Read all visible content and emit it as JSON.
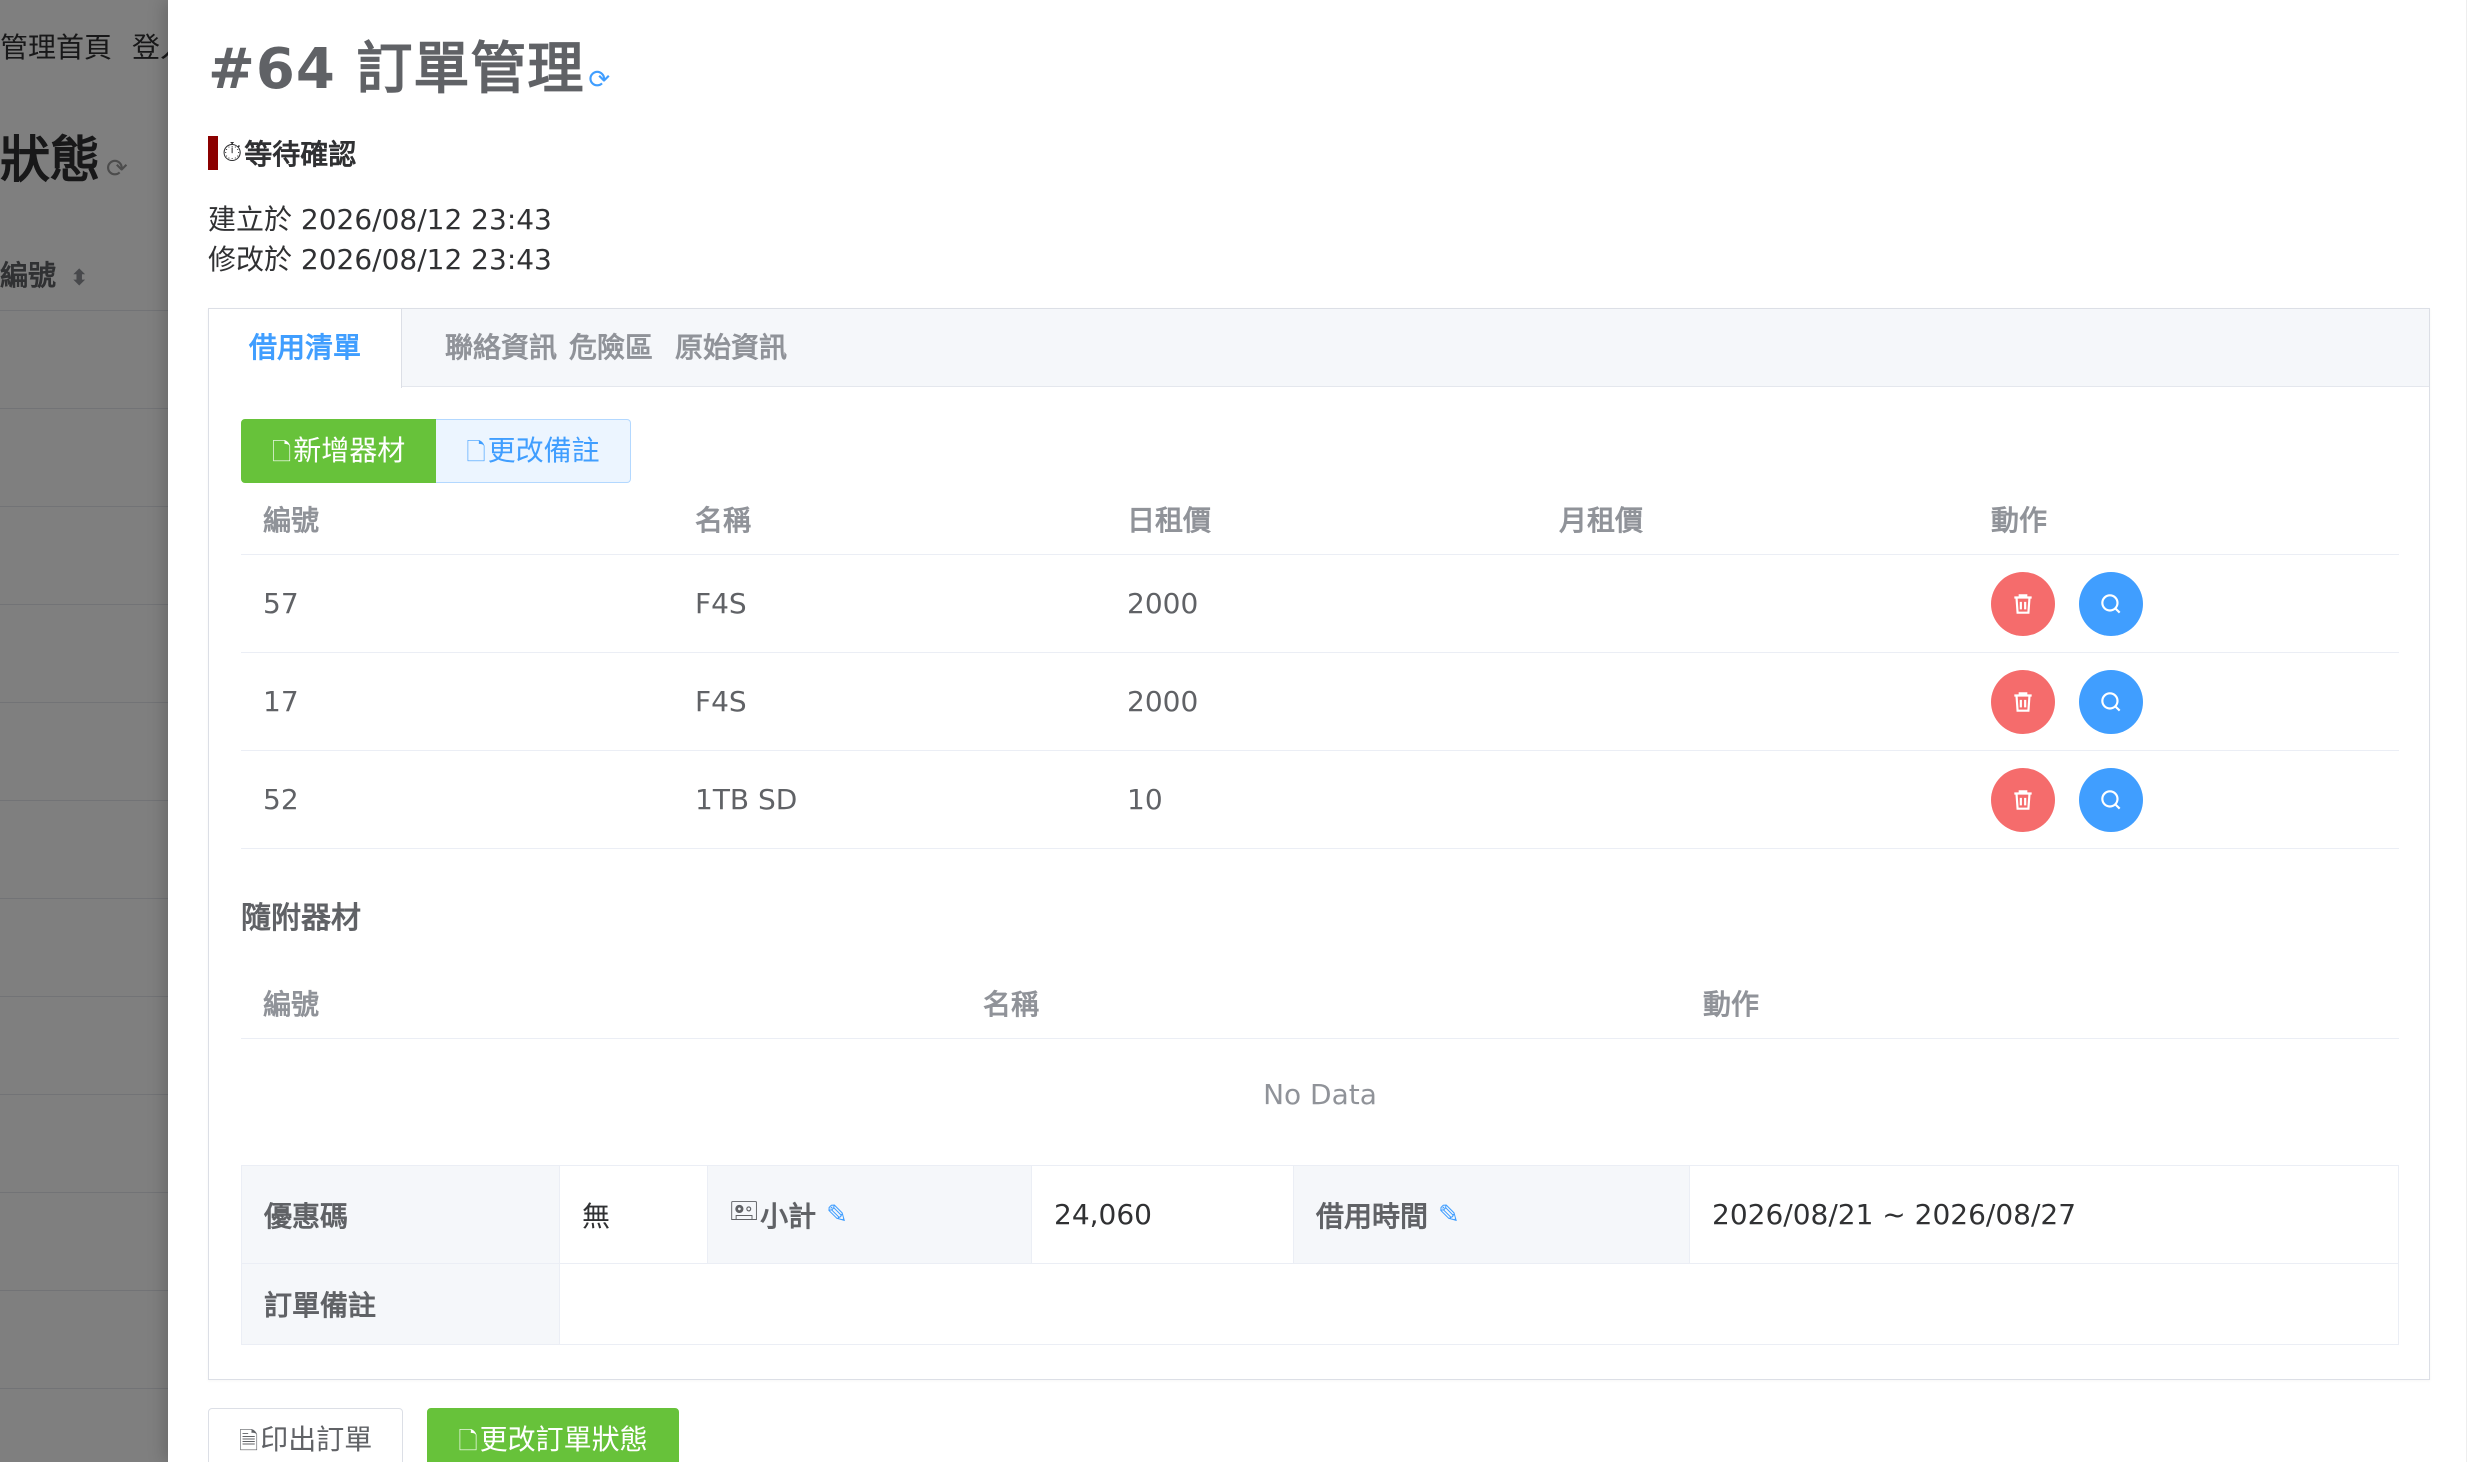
{
  "background": {
    "nav_items": [
      "管理首頁",
      "登入"
    ],
    "page_title": "狀態",
    "column_header": "編號"
  },
  "drawer": {
    "title": "#64 訂單管理",
    "status": "等待確認",
    "created": "建立於 2026/08/12 23:43",
    "modified": "修改於 2026/08/12 23:43",
    "tabs": [
      {
        "label": "借用清單",
        "active": true
      },
      {
        "label": "聯絡資訊",
        "active": false
      },
      {
        "label": "危險區",
        "active": false
      },
      {
        "label": "原始資訊",
        "active": false
      }
    ],
    "actions": {
      "add_equipment": "新增器材",
      "change_note": "更改備註"
    },
    "equipment_table": {
      "headers": [
        "編號",
        "名稱",
        "日租價",
        "月租價",
        "動作"
      ],
      "rows": [
        {
          "id": "57",
          "name": "F4S",
          "daily": "2000",
          "monthly": ""
        },
        {
          "id": "17",
          "name": "F4S",
          "daily": "2000",
          "monthly": ""
        },
        {
          "id": "52",
          "name": "1TB SD",
          "daily": "10",
          "monthly": ""
        }
      ]
    },
    "accessories": {
      "title": "隨附器材",
      "headers": [
        "編號",
        "名稱",
        "動作"
      ],
      "empty_text": "No Data"
    },
    "summary": {
      "coupon_label": "優惠碼",
      "coupon_value": "無",
      "subtotal_label": "小計",
      "subtotal_value": "24,060",
      "period_label": "借用時間",
      "period_value": "2026/08/21 ~ 2026/08/27",
      "note_label": "訂單備註",
      "note_value": ""
    },
    "footer": {
      "print_label": "印出訂單",
      "change_status_label": "更改訂單狀態"
    }
  },
  "colors": {
    "primary": "#409eff",
    "success": "#67c23a",
    "danger": "#f56c6c",
    "status_bar": "#8b0000"
  }
}
